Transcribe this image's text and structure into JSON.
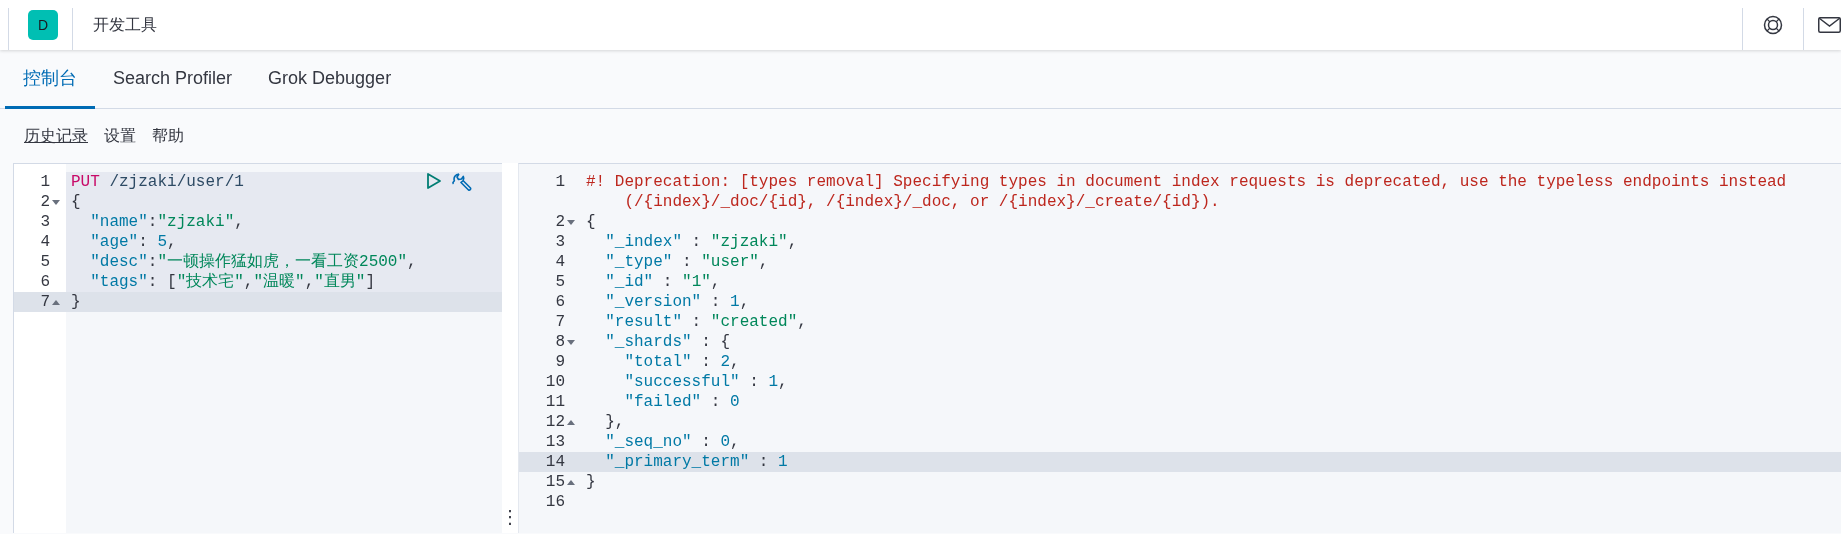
{
  "header": {
    "logo": "D",
    "title": "开发工具"
  },
  "tabs": [
    {
      "label": "控制台",
      "selected": true
    },
    {
      "label": "Search Profiler",
      "selected": false
    },
    {
      "label": "Grok Debugger",
      "selected": false
    }
  ],
  "menu": [
    "历史记录",
    "设置",
    "帮助"
  ],
  "request_editor": {
    "lines": [
      {
        "number": "1",
        "fold_start": false,
        "fold_end": false,
        "highlighted": true,
        "current": false,
        "tokens": [
          {
            "kind": "method",
            "text": "PUT"
          },
          {
            "kind": "url",
            "text": " /zjzaki/user/1"
          }
        ]
      },
      {
        "number": "2",
        "fold_start": true,
        "fold_end": false,
        "highlighted": true,
        "current": false,
        "tokens": [
          {
            "kind": "punct",
            "text": "{"
          }
        ]
      },
      {
        "number": "3",
        "fold_start": false,
        "fold_end": false,
        "highlighted": true,
        "current": false,
        "tokens": [
          {
            "kind": "key",
            "text": "  \"name\""
          },
          {
            "kind": "punct",
            "text": ":"
          },
          {
            "kind": "string",
            "text": "\"zjzaki\""
          },
          {
            "kind": "punct",
            "text": ","
          }
        ]
      },
      {
        "number": "4",
        "fold_start": false,
        "fold_end": false,
        "highlighted": true,
        "current": false,
        "tokens": [
          {
            "kind": "key",
            "text": "  \"age\""
          },
          {
            "kind": "punct",
            "text": ": "
          },
          {
            "kind": "number",
            "text": "5"
          },
          {
            "kind": "punct",
            "text": ","
          }
        ]
      },
      {
        "number": "5",
        "fold_start": false,
        "fold_end": false,
        "highlighted": true,
        "current": false,
        "tokens": [
          {
            "kind": "key",
            "text": "  \"desc\""
          },
          {
            "kind": "punct",
            "text": ":"
          },
          {
            "kind": "string",
            "text": "\"一顿操作猛如虎，一看工资2500\""
          },
          {
            "kind": "punct",
            "text": ","
          }
        ]
      },
      {
        "number": "6",
        "fold_start": false,
        "fold_end": false,
        "highlighted": true,
        "current": false,
        "tokens": [
          {
            "kind": "key",
            "text": "  \"tags\""
          },
          {
            "kind": "punct",
            "text": ": ["
          },
          {
            "kind": "string",
            "text": "\"技术宅\""
          },
          {
            "kind": "punct",
            "text": ","
          },
          {
            "kind": "string",
            "text": "\"温暖\""
          },
          {
            "kind": "punct",
            "text": ","
          },
          {
            "kind": "string",
            "text": "\"直男\""
          },
          {
            "kind": "punct",
            "text": "]"
          }
        ]
      },
      {
        "number": "7",
        "fold_start": false,
        "fold_end": true,
        "highlighted": false,
        "current": true,
        "tokens": [
          {
            "kind": "punct",
            "text": "}"
          }
        ]
      }
    ]
  },
  "resizer": "⋮",
  "response_editor": {
    "lines": [
      {
        "number": "1",
        "fold_start": false,
        "fold_end": false,
        "current": false,
        "tokens": [
          {
            "kind": "comment",
            "text": "#! Deprecation: [types removal] Specifying types in document index requests is deprecated, use the typeless endpoints instead (/{index}/_doc/{id}, /{index}/_doc, or /{index}/_create/{id})."
          }
        ]
      },
      {
        "number": "2",
        "fold_start": true,
        "fold_end": false,
        "current": false,
        "tokens": [
          {
            "kind": "punct",
            "text": "{"
          }
        ]
      },
      {
        "number": "3",
        "fold_start": false,
        "fold_end": false,
        "current": false,
        "tokens": [
          {
            "kind": "key",
            "text": "  \"_index\""
          },
          {
            "kind": "punct",
            "text": " : "
          },
          {
            "kind": "string",
            "text": "\"zjzaki\""
          },
          {
            "kind": "punct",
            "text": ","
          }
        ]
      },
      {
        "number": "4",
        "fold_start": false,
        "fold_end": false,
        "current": false,
        "tokens": [
          {
            "kind": "key",
            "text": "  \"_type\""
          },
          {
            "kind": "punct",
            "text": " : "
          },
          {
            "kind": "string",
            "text": "\"user\""
          },
          {
            "kind": "punct",
            "text": ","
          }
        ]
      },
      {
        "number": "5",
        "fold_start": false,
        "fold_end": false,
        "current": false,
        "tokens": [
          {
            "kind": "key",
            "text": "  \"_id\""
          },
          {
            "kind": "punct",
            "text": " : "
          },
          {
            "kind": "string",
            "text": "\"1\""
          },
          {
            "kind": "punct",
            "text": ","
          }
        ]
      },
      {
        "number": "6",
        "fold_start": false,
        "fold_end": false,
        "current": false,
        "tokens": [
          {
            "kind": "key",
            "text": "  \"_version\""
          },
          {
            "kind": "punct",
            "text": " : "
          },
          {
            "kind": "number",
            "text": "1"
          },
          {
            "kind": "punct",
            "text": ","
          }
        ]
      },
      {
        "number": "7",
        "fold_start": false,
        "fold_end": false,
        "current": false,
        "tokens": [
          {
            "kind": "key",
            "text": "  \"result\""
          },
          {
            "kind": "punct",
            "text": " : "
          },
          {
            "kind": "string",
            "text": "\"created\""
          },
          {
            "kind": "punct",
            "text": ","
          }
        ]
      },
      {
        "number": "8",
        "fold_start": true,
        "fold_end": false,
        "current": false,
        "tokens": [
          {
            "kind": "key",
            "text": "  \"_shards\""
          },
          {
            "kind": "punct",
            "text": " : {"
          }
        ]
      },
      {
        "number": "9",
        "fold_start": false,
        "fold_end": false,
        "current": false,
        "tokens": [
          {
            "kind": "key",
            "text": "    \"total\""
          },
          {
            "kind": "punct",
            "text": " : "
          },
          {
            "kind": "number",
            "text": "2"
          },
          {
            "kind": "punct",
            "text": ","
          }
        ]
      },
      {
        "number": "10",
        "fold_start": false,
        "fold_end": false,
        "current": false,
        "tokens": [
          {
            "kind": "key",
            "text": "    \"successful\""
          },
          {
            "kind": "punct",
            "text": " : "
          },
          {
            "kind": "number",
            "text": "1"
          },
          {
            "kind": "punct",
            "text": ","
          }
        ]
      },
      {
        "number": "11",
        "fold_start": false,
        "fold_end": false,
        "current": false,
        "tokens": [
          {
            "kind": "key",
            "text": "    \"failed\""
          },
          {
            "kind": "punct",
            "text": " : "
          },
          {
            "kind": "number",
            "text": "0"
          }
        ]
      },
      {
        "number": "12",
        "fold_start": false,
        "fold_end": true,
        "current": false,
        "tokens": [
          {
            "kind": "punct",
            "text": "  },"
          }
        ]
      },
      {
        "number": "13",
        "fold_start": false,
        "fold_end": false,
        "current": false,
        "tokens": [
          {
            "kind": "key",
            "text": "  \"_seq_no\""
          },
          {
            "kind": "punct",
            "text": " : "
          },
          {
            "kind": "number",
            "text": "0"
          },
          {
            "kind": "punct",
            "text": ","
          }
        ]
      },
      {
        "number": "14",
        "fold_start": false,
        "fold_end": false,
        "current": true,
        "tokens": [
          {
            "kind": "key",
            "text": "  \"_primary_term\""
          },
          {
            "kind": "punct",
            "text": " : "
          },
          {
            "kind": "number",
            "text": "1"
          }
        ]
      },
      {
        "number": "15",
        "fold_start": false,
        "fold_end": true,
        "current": false,
        "tokens": [
          {
            "kind": "punct",
            "text": "}"
          }
        ]
      },
      {
        "number": "16",
        "fold_start": false,
        "fold_end": false,
        "current": false
      }
    ]
  }
}
